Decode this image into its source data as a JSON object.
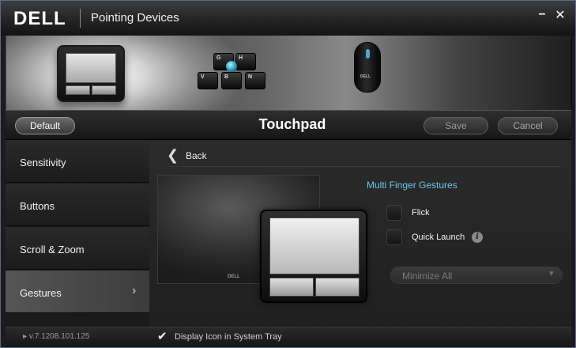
{
  "window": {
    "brand": "DELL",
    "title": "Pointing Devices",
    "minimize_glyph": "–",
    "close_glyph": "✕"
  },
  "banner": {
    "devices": [
      "touchpad",
      "keyboard-stick",
      "mouse"
    ],
    "keys": [
      "G",
      "H",
      "V",
      "B",
      "N"
    ],
    "mouse_logo": "DELL"
  },
  "header": {
    "default_label": "Default",
    "title": "Touchpad",
    "save_label": "Save",
    "cancel_label": "Cancel"
  },
  "sidebar": {
    "items": [
      {
        "label": "Sensitivity"
      },
      {
        "label": "Buttons"
      },
      {
        "label": "Scroll & Zoom"
      },
      {
        "label": "Gestures",
        "active": true
      }
    ],
    "active_chevron": "›"
  },
  "content": {
    "back_label": "Back",
    "laptop_brand": "DELL",
    "section_title": "Multi Finger Gestures",
    "options": [
      {
        "label": "Flick",
        "checked": false
      },
      {
        "label": "Quick Launch",
        "checked": false,
        "info": true
      }
    ],
    "dropdown_value": "Minimize All"
  },
  "footer": {
    "version": "v.7.1208.101.125",
    "tray_label": "Display Icon in System Tray",
    "tray_checked": true
  },
  "colors": {
    "accent": "#6ec5e8",
    "wheel": "#4aa9c9"
  }
}
